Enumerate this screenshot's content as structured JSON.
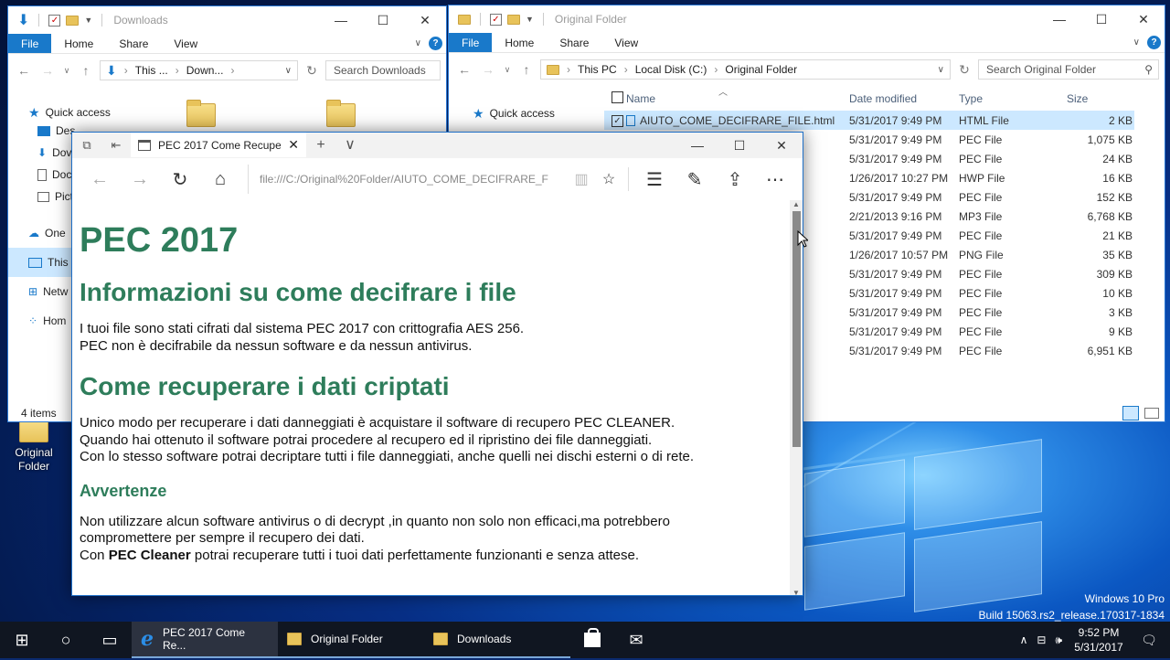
{
  "desktop": {
    "icon_label": "Original Folder",
    "watermark_line1": "Windows 10 Pro",
    "watermark_line2": "Build 15063.rs2_release.170317-1834"
  },
  "downloads_window": {
    "title": "Downloads",
    "ribbon": {
      "file": "File",
      "tabs": [
        "Home",
        "Share",
        "View"
      ]
    },
    "address": [
      "This ...",
      "Down..."
    ],
    "search_placeholder": "Search Downloads",
    "nav": {
      "quick_access": "Quick access",
      "items": [
        "Des",
        "Dov",
        "Doc",
        "Pict"
      ],
      "onedrive": "One",
      "thispc": "This",
      "network": "Netw",
      "homegroup": "Hom"
    },
    "status": "4 items"
  },
  "original_window": {
    "title": "Original Folder",
    "ribbon": {
      "file": "File",
      "tabs": [
        "Home",
        "Share",
        "View"
      ]
    },
    "address": [
      "This PC",
      "Local Disk (C:)",
      "Original Folder"
    ],
    "search_placeholder": "Search Original Folder",
    "nav": {
      "quick_access": "Quick access"
    },
    "columns": {
      "name": "Name",
      "date": "Date modified",
      "type": "Type",
      "size": "Size"
    },
    "files": [
      {
        "name": "AIUTO_COME_DECIFRARE_FILE.html",
        "date": "5/31/2017 9:49 PM",
        "type": "HTML File",
        "size": "2 KB"
      },
      {
        "name": "",
        "date": "5/31/2017 9:49 PM",
        "type": "PEC File",
        "size": "1,075 KB"
      },
      {
        "name": "",
        "date": "5/31/2017 9:49 PM",
        "type": "PEC File",
        "size": "24 KB"
      },
      {
        "name": "",
        "date": "1/26/2017 10:27 PM",
        "type": "HWP File",
        "size": "16 KB"
      },
      {
        "name": "",
        "date": "5/31/2017 9:49 PM",
        "type": "PEC File",
        "size": "152 KB"
      },
      {
        "name": "",
        "date": "2/21/2013 9:16 PM",
        "type": "MP3 File",
        "size": "6,768 KB"
      },
      {
        "name": "",
        "date": "5/31/2017 9:49 PM",
        "type": "PEC File",
        "size": "21 KB"
      },
      {
        "name": "",
        "date": "1/26/2017 10:57 PM",
        "type": "PNG File",
        "size": "35 KB"
      },
      {
        "name": "",
        "date": "5/31/2017 9:49 PM",
        "type": "PEC File",
        "size": "309 KB"
      },
      {
        "name": "",
        "date": "5/31/2017 9:49 PM",
        "type": "PEC File",
        "size": "10 KB"
      },
      {
        "name": "",
        "date": "5/31/2017 9:49 PM",
        "type": "PEC File",
        "size": "3 KB"
      },
      {
        "name": "",
        "date": "5/31/2017 9:49 PM",
        "type": "PEC File",
        "size": "9 KB"
      },
      {
        "name": "",
        "date": "5/31/2017 9:49 PM",
        "type": "PEC File",
        "size": "6,951 KB"
      }
    ]
  },
  "edge": {
    "tab_title": "PEC 2017 Come Recupe",
    "url": "file:///C:/Original%20Folder/AIUTO_COME_DECIFRARE_F",
    "page": {
      "h1": "PEC 2017",
      "h2a": "Informazioni su come decifrare i file",
      "p1_line1": "I tuoi file sono stati cifrati dal sistema PEC 2017 con crittografia AES 256.",
      "p1_line2": "PEC non è decifrabile da nessun software e da nessun antivirus.",
      "h2b": "Come recuperare i dati criptati",
      "p2_line1": "Unico modo per recuperare i dati danneggiati è acquistare il software di recupero PEC CLEANER.",
      "p2_line2": "Quando hai ottenuto il software potrai procedere al recupero ed il ripristino dei file danneggiati.",
      "p2_line3": "Con lo stesso software potrai decriptare tutti i file danneggiati, anche quelli nei dischi esterni o di rete.",
      "h3": "Avvertenze",
      "p3_line1": "Non utilizzare alcun software antivirus o di decrypt ,in quanto non solo non efficaci,ma potrebbero",
      "p3_line2": "compromettere per sempre il recupero dei dati.",
      "p3_pre": "Con ",
      "p3_bold": "PEC Cleaner",
      "p3_post": " potrai recuperare tutti i tuoi dati perfettamente funzionanti e senza attese."
    }
  },
  "taskbar": {
    "apps": [
      "PEC 2017 Come Re...",
      "Original Folder",
      "Downloads"
    ],
    "time": "9:52 PM",
    "date": "5/31/2017"
  }
}
